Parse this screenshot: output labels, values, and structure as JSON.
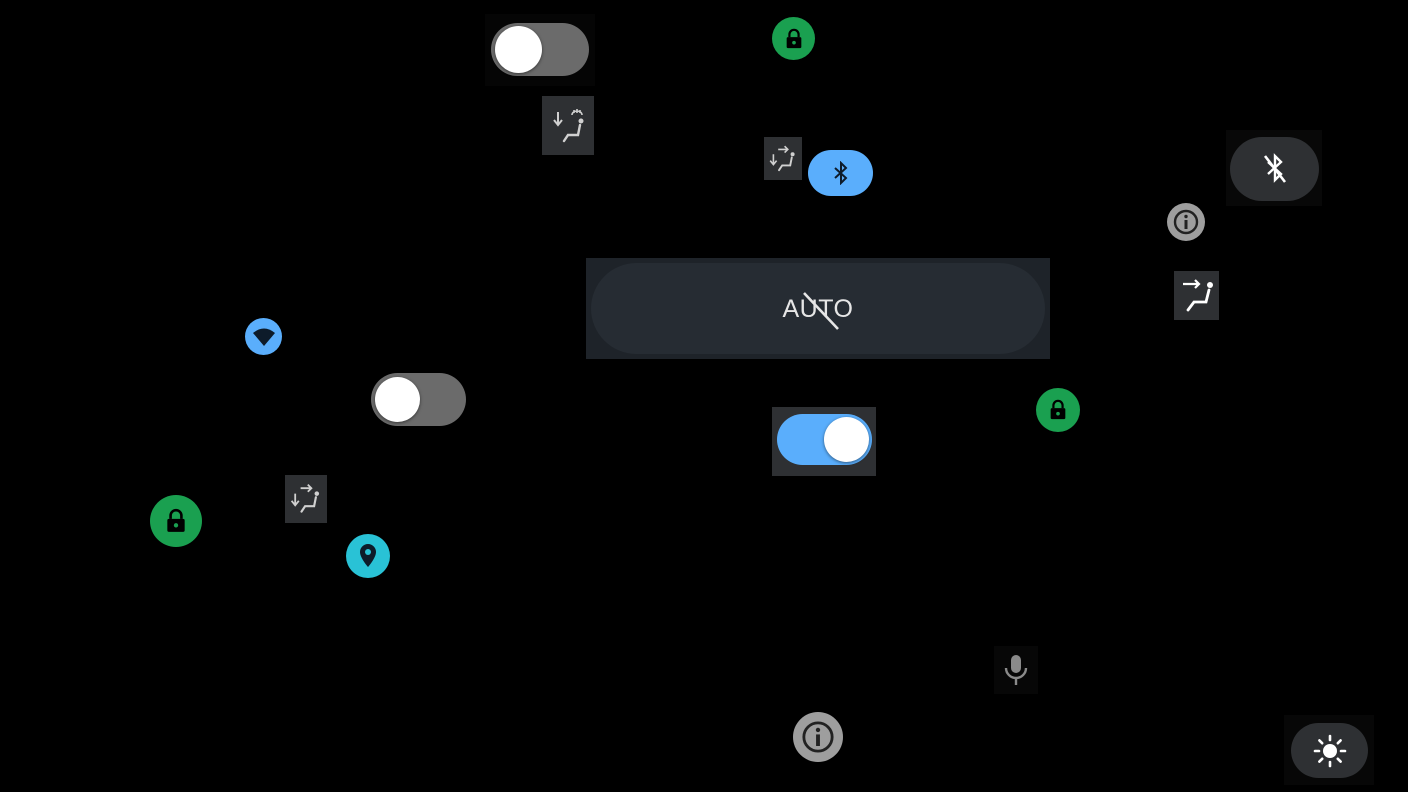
{
  "colors": {
    "background": "#000000",
    "toggle_off_track": "#6b6b6b",
    "toggle_on_track": "#5aaefc",
    "lock_green": "#1aa050",
    "bluetooth_blue": "#5aaefc",
    "location_cyan": "#29c2d6",
    "info_gray": "#9e9e9e",
    "tile_dark": "#2e3033",
    "auto_panel": "#1e2329",
    "auto_pill": "#262c33"
  },
  "toggles": {
    "top": {
      "state": "off"
    },
    "middle_left": {
      "state": "off"
    },
    "center": {
      "state": "on"
    }
  },
  "auto_button": {
    "label": "AUTO",
    "state": "disabled"
  },
  "icons": [
    "lock-icon",
    "seat-defrost-icon",
    "seat-airflow-icon",
    "bluetooth-icon",
    "bluetooth-disabled-icon",
    "info-icon",
    "wifi-icon",
    "location-pin-icon",
    "microphone-icon",
    "brightness-icon"
  ]
}
